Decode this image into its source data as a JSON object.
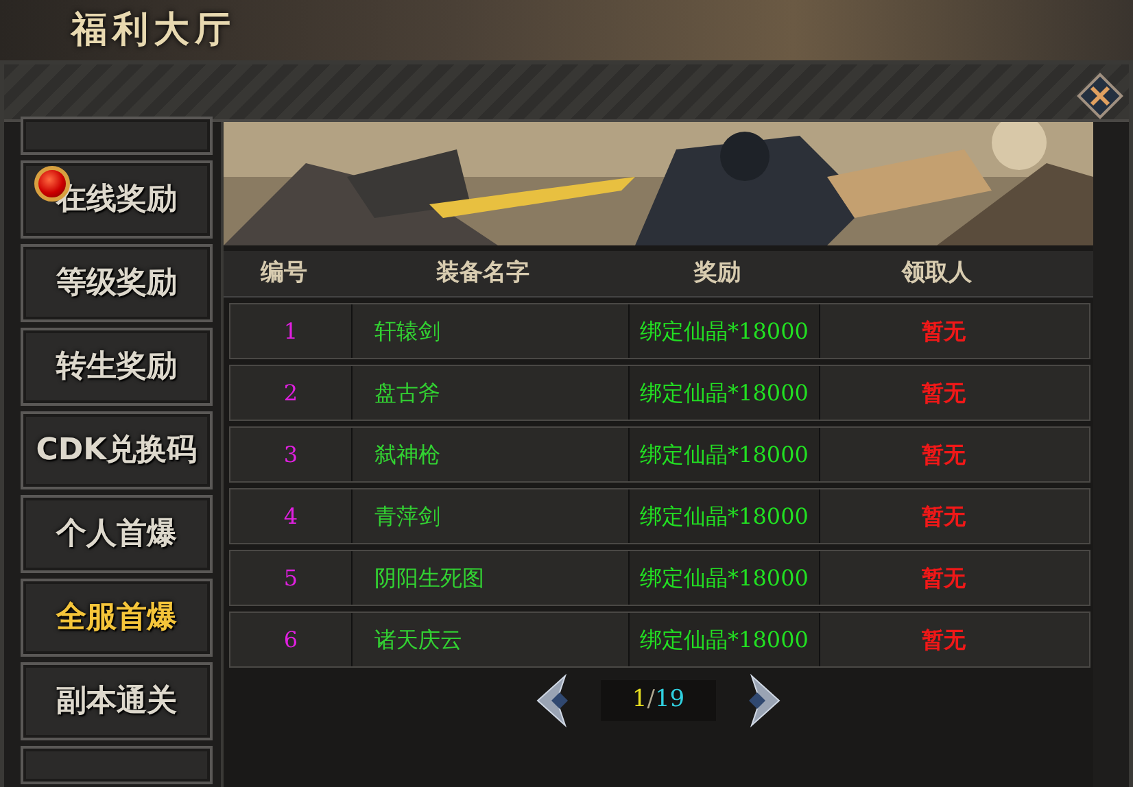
{
  "window": {
    "title": "福利大厅"
  },
  "sidebar": {
    "items": [
      {
        "label": "在线奖励",
        "selected": false,
        "badge": true
      },
      {
        "label": "等级奖励",
        "selected": false,
        "badge": false
      },
      {
        "label": "转生奖励",
        "selected": false,
        "badge": false
      },
      {
        "label": "CDK兑换码",
        "selected": false,
        "badge": false
      },
      {
        "label": "个人首爆",
        "selected": false,
        "badge": false
      },
      {
        "label": "全服首爆",
        "selected": true,
        "badge": false
      },
      {
        "label": "副本通关",
        "selected": false,
        "badge": false
      }
    ]
  },
  "table": {
    "columns": [
      "编号",
      "装备名字",
      "奖励",
      "领取人"
    ],
    "rows": [
      [
        "1",
        "轩辕剑",
        "绑定仙晶*18000",
        "暂无"
      ],
      [
        "2",
        "盘古斧",
        "绑定仙晶*18000",
        "暂无"
      ],
      [
        "3",
        "弑神枪",
        "绑定仙晶*18000",
        "暂无"
      ],
      [
        "4",
        "青萍剑",
        "绑定仙晶*18000",
        "暂无"
      ],
      [
        "5",
        "阴阳生死图",
        "绑定仙晶*18000",
        "暂无"
      ],
      [
        "6",
        "诸天庆云",
        "绑定仙晶*18000",
        "暂无"
      ]
    ]
  },
  "pager": {
    "current": "1",
    "separator": "/",
    "total": "19"
  }
}
